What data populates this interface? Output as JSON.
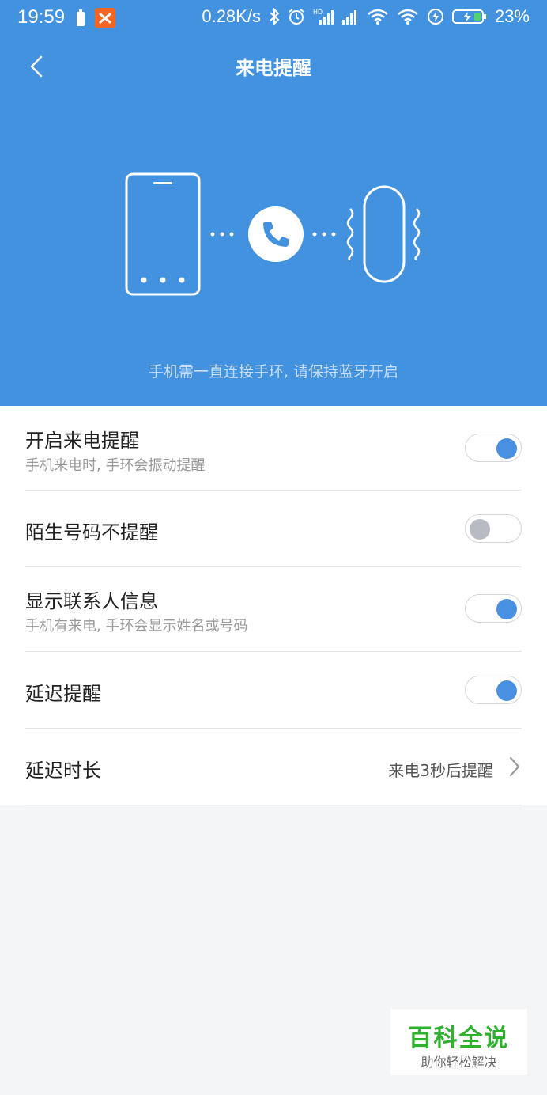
{
  "status_bar": {
    "time": "19:59",
    "net_speed": "0.28K/s",
    "battery": "23%",
    "icons": [
      "battery-small-icon",
      "app-notification-icon",
      "bluetooth-icon",
      "alarm-icon",
      "signal-hd-icon",
      "signal-icon",
      "wifi-icon",
      "wifi-icon",
      "flash-icon",
      "battery-charging-icon"
    ]
  },
  "header": {
    "title": "来电提醒",
    "back_icon": "chevron-left-icon"
  },
  "illustration": {
    "icons": [
      "phone-outline-icon",
      "call-icon",
      "band-icon"
    ],
    "hint": "手机需一直连接手环, 请保持蓝牙开启"
  },
  "settings": [
    {
      "title": "开启来电提醒",
      "subtitle": "手机来电时, 手环会振动提醒",
      "toggle": "on"
    },
    {
      "title": "陌生号码不提醒",
      "subtitle": "",
      "toggle": "off"
    },
    {
      "title": "显示联系人信息",
      "subtitle": "手机有来电, 手环会显示姓名或号码",
      "toggle": "on"
    },
    {
      "title": "延迟提醒",
      "subtitle": "",
      "toggle": "on"
    },
    {
      "title": "延迟时长",
      "value": "来电3秒后提醒",
      "icon": "chevron-right-icon"
    }
  ],
  "watermark": {
    "title": "百科全说",
    "subtitle": "助你轻松解决"
  },
  "colors": {
    "hero": "#4292e0",
    "toggle_on": "#4a90e2",
    "toggle_off": "#b8bcc2",
    "watermark": "#2fb02f"
  }
}
